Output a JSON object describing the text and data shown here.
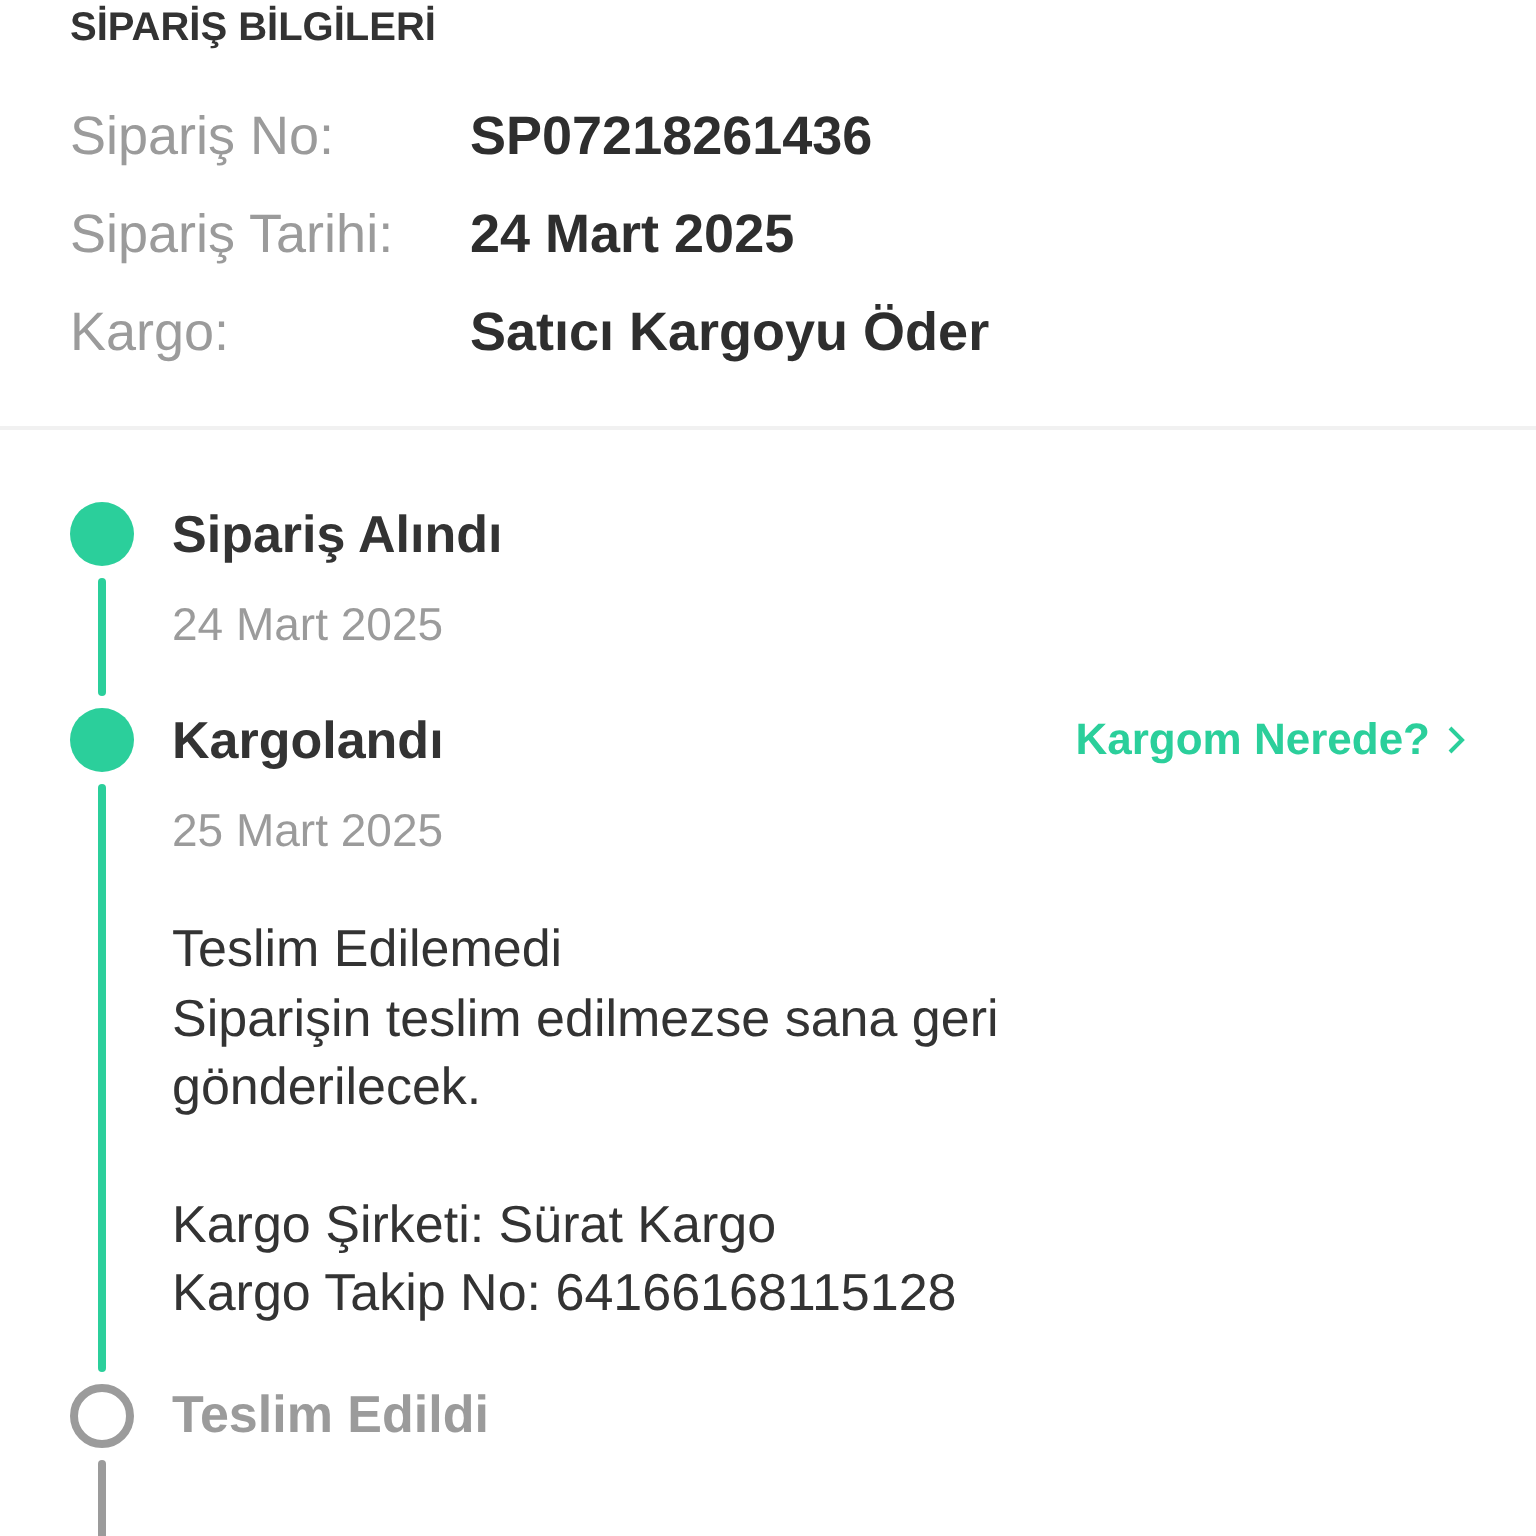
{
  "section_title": "SİPARİŞ BİLGİLERİ",
  "order_info": [
    {
      "label": "Sipariş No:",
      "value": "SP07218261436"
    },
    {
      "label": "Sipariş Tarihi:",
      "value": "24 Mart 2025"
    },
    {
      "label": "Kargo:",
      "value": "Satıcı Kargoyu Öder"
    }
  ],
  "timeline": [
    {
      "title": "Sipariş Alındı",
      "completed": true,
      "date": "24 Mart 2025"
    },
    {
      "title": "Kargolandı",
      "completed": true,
      "date": "25 Mart 2025",
      "link": "Kargom Nerede?",
      "paragraphs": [
        [
          "Teslim Edilemedi",
          "Siparişin teslim edilmezse sana geri gönderilecek."
        ],
        [
          "Kargo Şirketi: Sürat Kargo",
          "Kargo Takip No: 64166168115128"
        ]
      ]
    },
    {
      "title": "Teslim Edildi",
      "completed": false
    }
  ]
}
